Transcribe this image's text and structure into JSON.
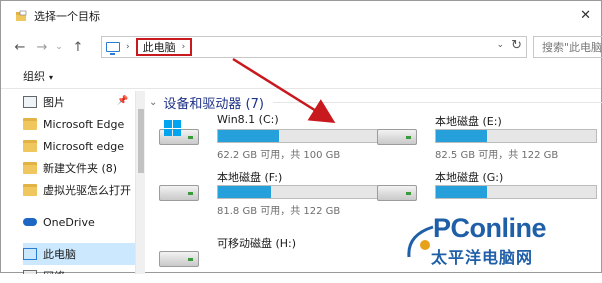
{
  "window": {
    "title": "选择一个目标"
  },
  "navigation": {
    "back_glyph": "←",
    "forward_glyph": "→",
    "recent_glyph": "⌄",
    "up_glyph": "↑"
  },
  "address": {
    "current": "此电脑",
    "separator": "›",
    "dropdown_glyph": "⌄",
    "refresh_glyph": "↻"
  },
  "search": {
    "placeholder": "搜索\"此电脑"
  },
  "toolbar": {
    "organize_label": "组织",
    "organize_caret": "▾"
  },
  "sidebar": {
    "items": [
      {
        "label": "图片",
        "icon": "picture-icon",
        "pinned": true
      },
      {
        "label": "Microsoft Edge",
        "icon": "folder-icon"
      },
      {
        "label": "Microsoft edge",
        "icon": "folder-icon"
      },
      {
        "label": "新建文件夹 (8)",
        "icon": "folder-icon"
      },
      {
        "label": "虚拟光驱怎么打开",
        "icon": "folder-icon"
      },
      {
        "label": "OneDrive",
        "icon": "onedrive-icon"
      },
      {
        "label": "此电脑",
        "icon": "this-pc-icon",
        "selected": true
      },
      {
        "label": "网络",
        "icon": "network-icon"
      }
    ]
  },
  "content": {
    "section_title": "设备和驱动器 (7)",
    "section_chevron": "⌄",
    "drives": [
      {
        "name": "Win8.1 (C:)",
        "free_text": "62.2 GB 可用，共 100 GB",
        "used_fraction": 0.38,
        "icon": "windows-drive-icon"
      },
      {
        "name": "本地磁盘 (E:)",
        "free_text": "82.5 GB 可用，共 122 GB",
        "used_fraction": 0.32,
        "icon": "hard-disk-icon"
      },
      {
        "name": "本地磁盘 (F:)",
        "free_text": "81.8 GB 可用，共 122 GB",
        "used_fraction": 0.33,
        "icon": "hard-disk-icon"
      },
      {
        "name": "本地磁盘 (G:)",
        "free_text": "",
        "used_fraction": 0.32,
        "icon": "hard-disk-icon"
      },
      {
        "name": "可移动磁盘 (H:)",
        "free_text": "",
        "icon": "removable-disk-icon"
      }
    ]
  },
  "watermark": {
    "logo": "PConline",
    "chinese": "太平洋电脑网"
  },
  "colors": {
    "highlight_box": "#c8191e",
    "arrow": "#c8191e",
    "usage_bar": "#26a0da",
    "selected_nav": "#cce8ff",
    "section_title": "#1e3287"
  }
}
